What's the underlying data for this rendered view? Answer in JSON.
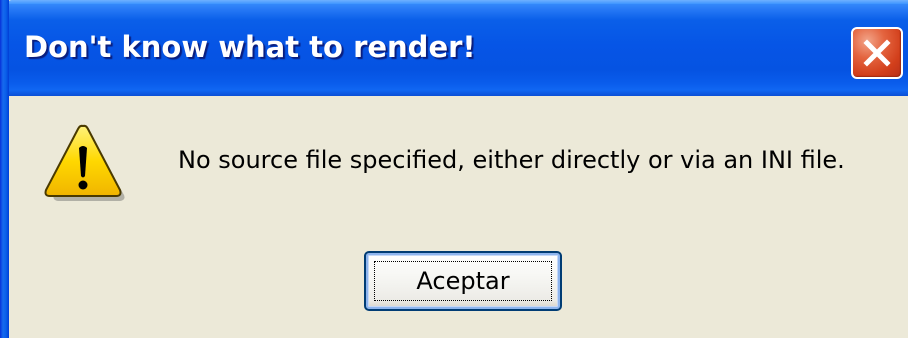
{
  "window": {
    "title": "Don't know what to render!",
    "close_icon": "close-icon"
  },
  "dialog": {
    "icon": "warning-icon",
    "message": "No source file specified, either directly or via an INI file.",
    "ok_label": "Aceptar"
  },
  "colors": {
    "titlebar_blue": "#0655e6",
    "close_red": "#d23f1b",
    "body_background": "#ece9d8",
    "warning_yellow": "#ffd800"
  }
}
